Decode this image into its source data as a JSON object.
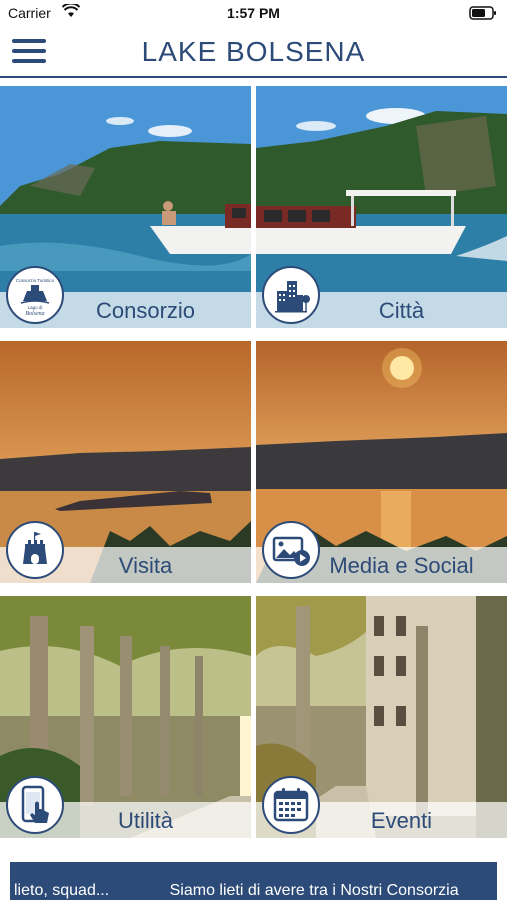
{
  "status_bar": {
    "carrier": "Carrier",
    "time": "1:57 PM"
  },
  "header": {
    "title": "LAKE BOLSENA",
    "menu_icon": "hamburger-menu-icon"
  },
  "tiles": [
    {
      "label": "Consorzio",
      "icon": "consorzio-logo-icon",
      "logo_text": [
        "Consorzio Turistico",
        "Lago di",
        "Bolsena"
      ]
    },
    {
      "label": "Città",
      "icon": "city-buildings-icon"
    },
    {
      "label": "Visita",
      "icon": "castle-tower-icon"
    },
    {
      "label": "Media e Social",
      "icon": "media-gallery-icon"
    },
    {
      "label": "Utilità",
      "icon": "phone-touch-icon"
    },
    {
      "label": "Eventi",
      "icon": "calendar-icon"
    }
  ],
  "ticker": {
    "items": [
      "lieto, squad...",
      "Siamo lieti di avere tra i Nostri Consorzia"
    ]
  },
  "colors": {
    "brand": "#2d4b78",
    "sky": "#3f8fd0",
    "sunset": "#c8772a"
  }
}
